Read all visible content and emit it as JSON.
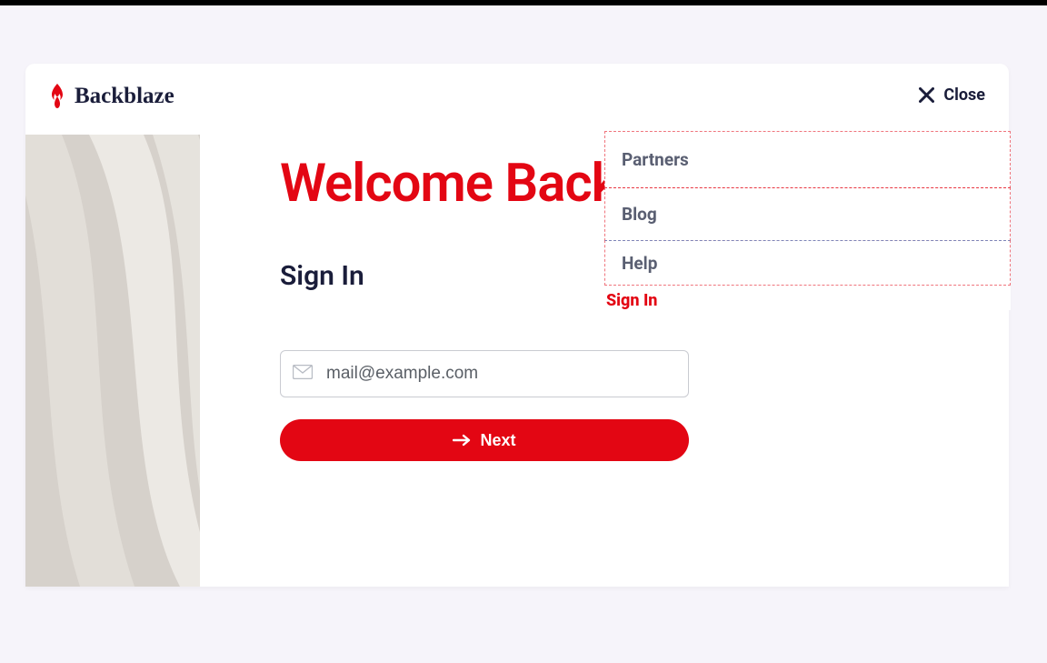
{
  "brand": {
    "name": "Backblaze"
  },
  "header": {
    "close": "Close"
  },
  "main": {
    "welcome": "Welcome Back",
    "signin_heading": "Sign In",
    "email_placeholder": "mail@example.com",
    "next_label": "Next"
  },
  "menu": {
    "items": [
      {
        "label": "Partners"
      },
      {
        "label": "Blog"
      },
      {
        "label": "Help"
      }
    ],
    "signin": "Sign In"
  },
  "colors": {
    "accent": "#e30613",
    "text_dark": "#1a1d3a",
    "page_bg": "#f6f4fa"
  }
}
